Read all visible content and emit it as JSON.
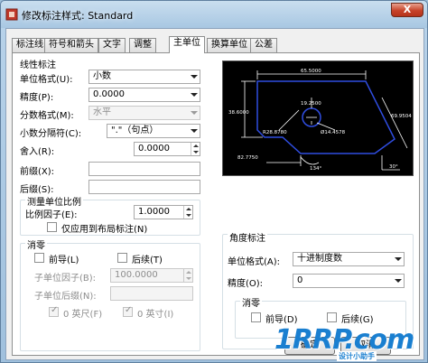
{
  "window": {
    "title": "修改标注样式: Standard",
    "close_glyph": "X"
  },
  "tabs": [
    {
      "label": "标注线"
    },
    {
      "label": "符号和箭头"
    },
    {
      "label": "文字"
    },
    {
      "label": "调整"
    },
    {
      "label": "主单位",
      "active": true
    },
    {
      "label": "换算单位"
    },
    {
      "label": "公差"
    }
  ],
  "linear": {
    "title": "线性标注",
    "unit_format": {
      "label": "单位格式(U):",
      "value": "小数"
    },
    "precision": {
      "label": "精度(P):",
      "value": "0.0000"
    },
    "fraction_format": {
      "label": "分数格式(M):",
      "value": "水平"
    },
    "decimal_separator": {
      "label": "小数分隔符(C):",
      "value": "\".\"（句点）"
    },
    "round_off": {
      "label": "舍入(R):",
      "value": "0.0000"
    },
    "prefix": {
      "label": "前缀(X):",
      "value": ""
    },
    "suffix": {
      "label": "后缀(S):",
      "value": ""
    }
  },
  "measurement_scale": {
    "title": "测量单位比例",
    "scale_factor": {
      "label": "比例因子(E):",
      "value": "1.0000"
    },
    "apply_layout": {
      "label": "仅应用到布局标注(N)"
    }
  },
  "zero_suppression_linear": {
    "title": "消零",
    "leading": {
      "label": "前导(L)"
    },
    "trailing": {
      "label": "后续(T)"
    },
    "sub_unit_factor": {
      "label": "子单位因子(B):",
      "value": "100.0000"
    },
    "sub_unit_suffix": {
      "label": "子单位后缀(N):",
      "value": ""
    },
    "feet": {
      "label": "0 英尺(F)"
    },
    "inches": {
      "label": "0 英寸(I)"
    }
  },
  "angular": {
    "title": "角度标注",
    "unit_format": {
      "label": "单位格式(A):",
      "value": "十进制度数"
    },
    "precision": {
      "label": "精度(O):",
      "value": "0"
    },
    "zero_title": "消零",
    "leading": {
      "label": "前导(D)"
    },
    "trailing": {
      "label": "后续(G)"
    }
  },
  "preview": {
    "dim_top": "65.5000",
    "dim_left": "38.6000",
    "dim_inner": "19.2500",
    "dim_right": "69.9504",
    "dim_radius": "R28.8780",
    "dim_arc": "Ø14.4578",
    "dim_bottom": "82.7750",
    "angle_bottom": "134°",
    "angle_right": "30°"
  },
  "buttons": {
    "ok": "确定",
    "cancel": "取消"
  },
  "watermark": {
    "main": "1RRP.com",
    "sub": "设计小助手"
  },
  "colors": {
    "accent": "#1a7fd0",
    "preview_lines": "#2f4de0",
    "close": "#c7432a"
  }
}
